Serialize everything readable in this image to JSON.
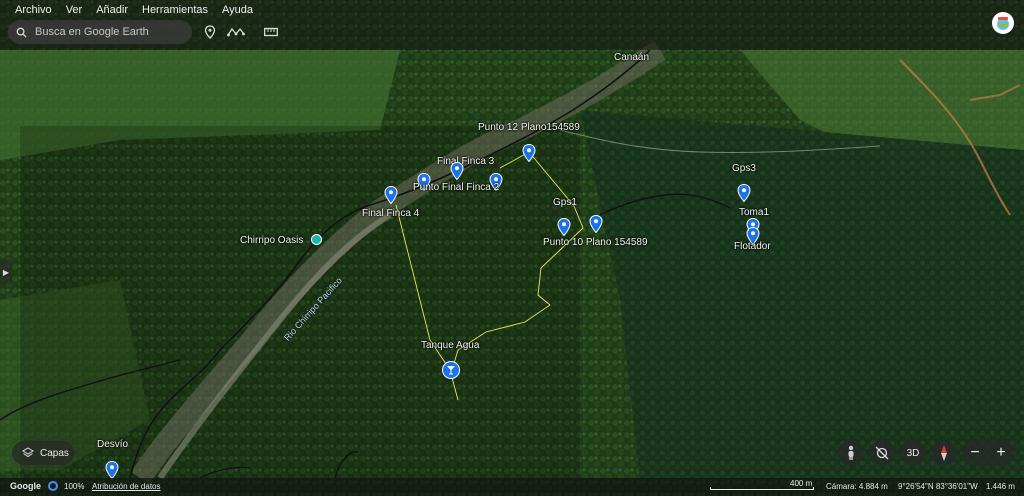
{
  "menu": {
    "items": [
      "Archivo",
      "Ver",
      "Añadir",
      "Herramientas",
      "Ayuda"
    ]
  },
  "search": {
    "placeholder": "Busca en Google Earth"
  },
  "icons": {
    "search": "search-icon",
    "place": "placemark-icon",
    "path": "path-icon",
    "measure": "ruler-icon",
    "layers": "layers-icon",
    "pegman": "pegman-icon",
    "orient": "orientation-icon",
    "compass": "compass-icon"
  },
  "map_labels": {
    "canaan": "Canaán",
    "punto12": "Punto 12 Plano154589",
    "final3": "Final Finca 3",
    "final2": "Punto Final Finca 2",
    "final4": "Final Finca 4",
    "chirripo": "Chirripo Oasis",
    "gps1": "Gps1",
    "punto10": "Punto 10 Plano 154589",
    "gps3": "Gps3",
    "toma1": "Toma1",
    "flotador": "Flotador",
    "tanque": "Tanque Agua",
    "rio": "Rio Chirripo Pacifico",
    "desvio": "Desvío"
  },
  "controls": {
    "layers_label": "Capas",
    "three_d": "3D",
    "zoom_out": "−",
    "zoom_in": "+"
  },
  "status": {
    "brand": "Google",
    "percent": "100%",
    "attribution": "Atribución de datos",
    "scale": "400 m",
    "camera": "Cámara: 4.884 m",
    "coords": "9°26'54\"N 83°36'01\"W",
    "elevation": "1.446 m"
  },
  "colors": {
    "pin_blue": "#1a73e8",
    "track_yellow": "#e8e86a",
    "road_black": "#111111"
  }
}
